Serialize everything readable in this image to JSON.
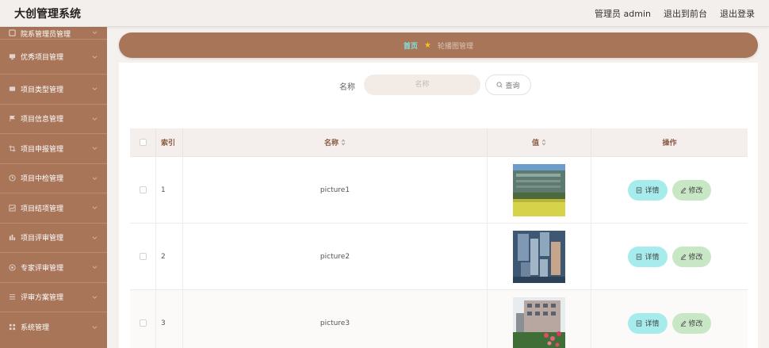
{
  "header": {
    "app_title": "大创管理系统",
    "admin_label": "管理员 admin",
    "front_link": "退出到前台",
    "logout_link": "退出登录"
  },
  "sidebar": {
    "items": [
      {
        "label": "院系管理员管理",
        "icon": "user-icon"
      },
      {
        "label": "优秀项目管理",
        "icon": "monitor-icon"
      },
      {
        "label": "项目类型管理",
        "icon": "chat-icon"
      },
      {
        "label": "项目信息管理",
        "icon": "flag-icon"
      },
      {
        "label": "项目申报管理",
        "icon": "crop-icon"
      },
      {
        "label": "项目中检管理",
        "icon": "clock-icon"
      },
      {
        "label": "项目结项管理",
        "icon": "chart-icon"
      },
      {
        "label": "项目评审管理",
        "icon": "bar-chart-icon"
      },
      {
        "label": "专家评审管理",
        "icon": "help-icon"
      },
      {
        "label": "评审方案管理",
        "icon": "list-icon"
      },
      {
        "label": "系统管理",
        "icon": "grid-icon"
      }
    ]
  },
  "breadcrumb": {
    "home": "首页",
    "current": "轮播图管理"
  },
  "search": {
    "label": "名称",
    "placeholder": "名称",
    "button_label": "查询"
  },
  "table": {
    "headers": {
      "index": "索引",
      "name": "名称",
      "value": "值",
      "actions": "操作"
    },
    "rows": [
      {
        "index": "1",
        "name": "picture1",
        "image": "campus-building-field"
      },
      {
        "index": "2",
        "name": "picture2",
        "image": "blue-abstract-blocks"
      },
      {
        "index": "3",
        "name": "picture3",
        "image": "building-with-flowers"
      }
    ],
    "detail_label": "详情",
    "edit_label": "修改"
  },
  "colors": {
    "accent": "#a87559",
    "detail_button": "#a6ecec",
    "edit_button": "#c8e8c5",
    "breadcrumb_home": "#7fe3e0"
  }
}
